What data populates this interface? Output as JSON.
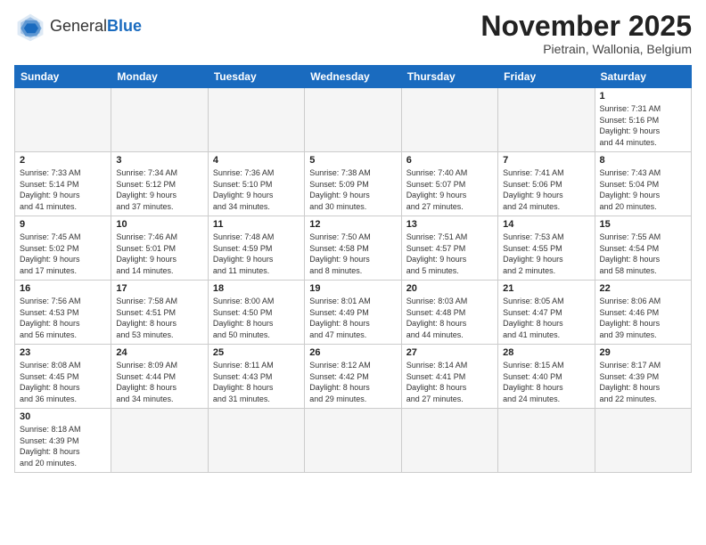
{
  "header": {
    "logo_general": "General",
    "logo_blue": "Blue",
    "month_title": "November 2025",
    "subtitle": "Pietrain, Wallonia, Belgium"
  },
  "weekdays": [
    "Sunday",
    "Monday",
    "Tuesday",
    "Wednesday",
    "Thursday",
    "Friday",
    "Saturday"
  ],
  "days": {
    "d1": {
      "num": "1",
      "info": "Sunrise: 7:31 AM\nSunset: 5:16 PM\nDaylight: 9 hours\nand 44 minutes."
    },
    "d2": {
      "num": "2",
      "info": "Sunrise: 7:33 AM\nSunset: 5:14 PM\nDaylight: 9 hours\nand 41 minutes."
    },
    "d3": {
      "num": "3",
      "info": "Sunrise: 7:34 AM\nSunset: 5:12 PM\nDaylight: 9 hours\nand 37 minutes."
    },
    "d4": {
      "num": "4",
      "info": "Sunrise: 7:36 AM\nSunset: 5:10 PM\nDaylight: 9 hours\nand 34 minutes."
    },
    "d5": {
      "num": "5",
      "info": "Sunrise: 7:38 AM\nSunset: 5:09 PM\nDaylight: 9 hours\nand 30 minutes."
    },
    "d6": {
      "num": "6",
      "info": "Sunrise: 7:40 AM\nSunset: 5:07 PM\nDaylight: 9 hours\nand 27 minutes."
    },
    "d7": {
      "num": "7",
      "info": "Sunrise: 7:41 AM\nSunset: 5:06 PM\nDaylight: 9 hours\nand 24 minutes."
    },
    "d8": {
      "num": "8",
      "info": "Sunrise: 7:43 AM\nSunset: 5:04 PM\nDaylight: 9 hours\nand 20 minutes."
    },
    "d9": {
      "num": "9",
      "info": "Sunrise: 7:45 AM\nSunset: 5:02 PM\nDaylight: 9 hours\nand 17 minutes."
    },
    "d10": {
      "num": "10",
      "info": "Sunrise: 7:46 AM\nSunset: 5:01 PM\nDaylight: 9 hours\nand 14 minutes."
    },
    "d11": {
      "num": "11",
      "info": "Sunrise: 7:48 AM\nSunset: 4:59 PM\nDaylight: 9 hours\nand 11 minutes."
    },
    "d12": {
      "num": "12",
      "info": "Sunrise: 7:50 AM\nSunset: 4:58 PM\nDaylight: 9 hours\nand 8 minutes."
    },
    "d13": {
      "num": "13",
      "info": "Sunrise: 7:51 AM\nSunset: 4:57 PM\nDaylight: 9 hours\nand 5 minutes."
    },
    "d14": {
      "num": "14",
      "info": "Sunrise: 7:53 AM\nSunset: 4:55 PM\nDaylight: 9 hours\nand 2 minutes."
    },
    "d15": {
      "num": "15",
      "info": "Sunrise: 7:55 AM\nSunset: 4:54 PM\nDaylight: 8 hours\nand 58 minutes."
    },
    "d16": {
      "num": "16",
      "info": "Sunrise: 7:56 AM\nSunset: 4:53 PM\nDaylight: 8 hours\nand 56 minutes."
    },
    "d17": {
      "num": "17",
      "info": "Sunrise: 7:58 AM\nSunset: 4:51 PM\nDaylight: 8 hours\nand 53 minutes."
    },
    "d18": {
      "num": "18",
      "info": "Sunrise: 8:00 AM\nSunset: 4:50 PM\nDaylight: 8 hours\nand 50 minutes."
    },
    "d19": {
      "num": "19",
      "info": "Sunrise: 8:01 AM\nSunset: 4:49 PM\nDaylight: 8 hours\nand 47 minutes."
    },
    "d20": {
      "num": "20",
      "info": "Sunrise: 8:03 AM\nSunset: 4:48 PM\nDaylight: 8 hours\nand 44 minutes."
    },
    "d21": {
      "num": "21",
      "info": "Sunrise: 8:05 AM\nSunset: 4:47 PM\nDaylight: 8 hours\nand 41 minutes."
    },
    "d22": {
      "num": "22",
      "info": "Sunrise: 8:06 AM\nSunset: 4:46 PM\nDaylight: 8 hours\nand 39 minutes."
    },
    "d23": {
      "num": "23",
      "info": "Sunrise: 8:08 AM\nSunset: 4:45 PM\nDaylight: 8 hours\nand 36 minutes."
    },
    "d24": {
      "num": "24",
      "info": "Sunrise: 8:09 AM\nSunset: 4:44 PM\nDaylight: 8 hours\nand 34 minutes."
    },
    "d25": {
      "num": "25",
      "info": "Sunrise: 8:11 AM\nSunset: 4:43 PM\nDaylight: 8 hours\nand 31 minutes."
    },
    "d26": {
      "num": "26",
      "info": "Sunrise: 8:12 AM\nSunset: 4:42 PM\nDaylight: 8 hours\nand 29 minutes."
    },
    "d27": {
      "num": "27",
      "info": "Sunrise: 8:14 AM\nSunset: 4:41 PM\nDaylight: 8 hours\nand 27 minutes."
    },
    "d28": {
      "num": "28",
      "info": "Sunrise: 8:15 AM\nSunset: 4:40 PM\nDaylight: 8 hours\nand 24 minutes."
    },
    "d29": {
      "num": "29",
      "info": "Sunrise: 8:17 AM\nSunset: 4:39 PM\nDaylight: 8 hours\nand 22 minutes."
    },
    "d30": {
      "num": "30",
      "info": "Sunrise: 8:18 AM\nSunset: 4:39 PM\nDaylight: 8 hours\nand 20 minutes."
    }
  }
}
